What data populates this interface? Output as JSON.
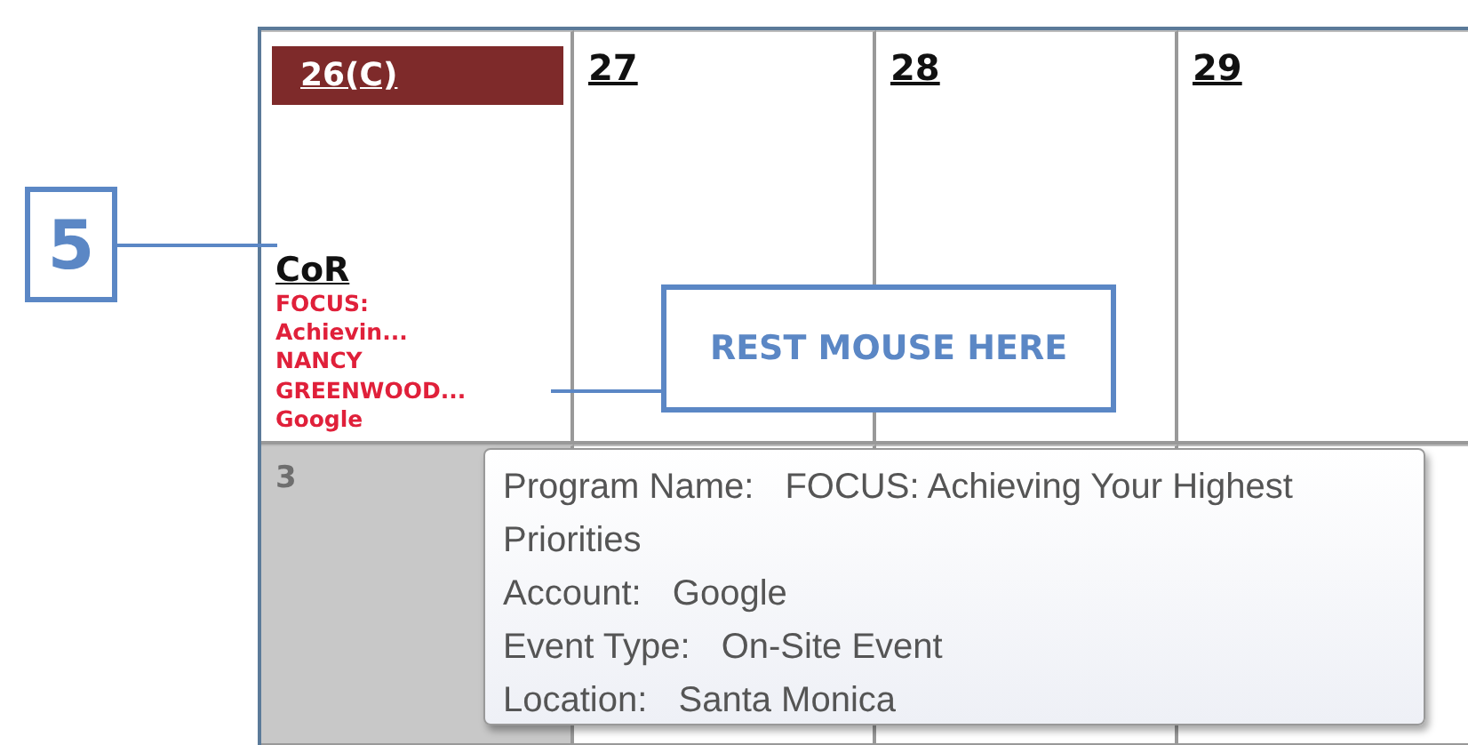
{
  "calendar": {
    "weeks": [
      {
        "days": [
          {
            "label": "26(C)",
            "highlighted": true,
            "greyed": false,
            "events": [
              {
                "title": "CoR",
                "lines": [
                  "FOCUS:",
                  "Achievin...",
                  "NANCY",
                  "GREENWOOD...",
                  "Google"
                ]
              }
            ]
          },
          {
            "label": "27",
            "highlighted": false,
            "greyed": false
          },
          {
            "label": "28",
            "highlighted": false,
            "greyed": false
          },
          {
            "label": "29",
            "highlighted": false,
            "greyed": false
          }
        ]
      },
      {
        "days": [
          {
            "label": "3",
            "highlighted": false,
            "greyed": true
          }
        ]
      }
    ]
  },
  "tooltip": {
    "fields": [
      {
        "label": "Program Name:",
        "value": "FOCUS: Achieving Your Highest Priorities"
      },
      {
        "label": "Account:",
        "value": "Google"
      },
      {
        "label": "Event Type:",
        "value": "On-Site Event"
      },
      {
        "label": "Location:",
        "value": "Santa Monica"
      }
    ]
  },
  "callouts": [
    {
      "kind": "number",
      "text": "5"
    },
    {
      "kind": "note",
      "text": "REST MOUSE HERE"
    }
  ]
}
